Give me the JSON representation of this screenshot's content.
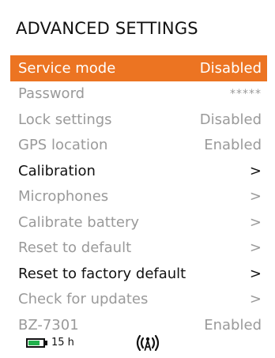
{
  "header": {
    "title": "ADVANCED SETTINGS"
  },
  "menu": {
    "items": [
      {
        "label": "Service mode",
        "value": "Disabled"
      },
      {
        "label": "Password",
        "value": "*****"
      },
      {
        "label": "Lock settings",
        "value": "Disabled"
      },
      {
        "label": "GPS location",
        "value": "Enabled"
      },
      {
        "label": "Calibration",
        "value": ">"
      },
      {
        "label": "Microphones",
        "value": ">"
      },
      {
        "label": "Calibrate battery",
        "value": ">"
      },
      {
        "label": "Reset to default",
        "value": ">"
      },
      {
        "label": "Reset to factory default",
        "value": ">"
      },
      {
        "label": "Check for updates",
        "value": ">"
      },
      {
        "label": "BZ-7301",
        "value": "Enabled"
      }
    ]
  },
  "statusbar": {
    "battery_level": 0.8,
    "battery_time": "15 h",
    "battery_icon": "battery-icon",
    "signal_icon": "wireless-signal-icon"
  },
  "colors": {
    "highlight": "#ec7422",
    "battery_fill": "#22b14c",
    "active_text": "#111111",
    "inactive_text": "#9a9a9a"
  }
}
